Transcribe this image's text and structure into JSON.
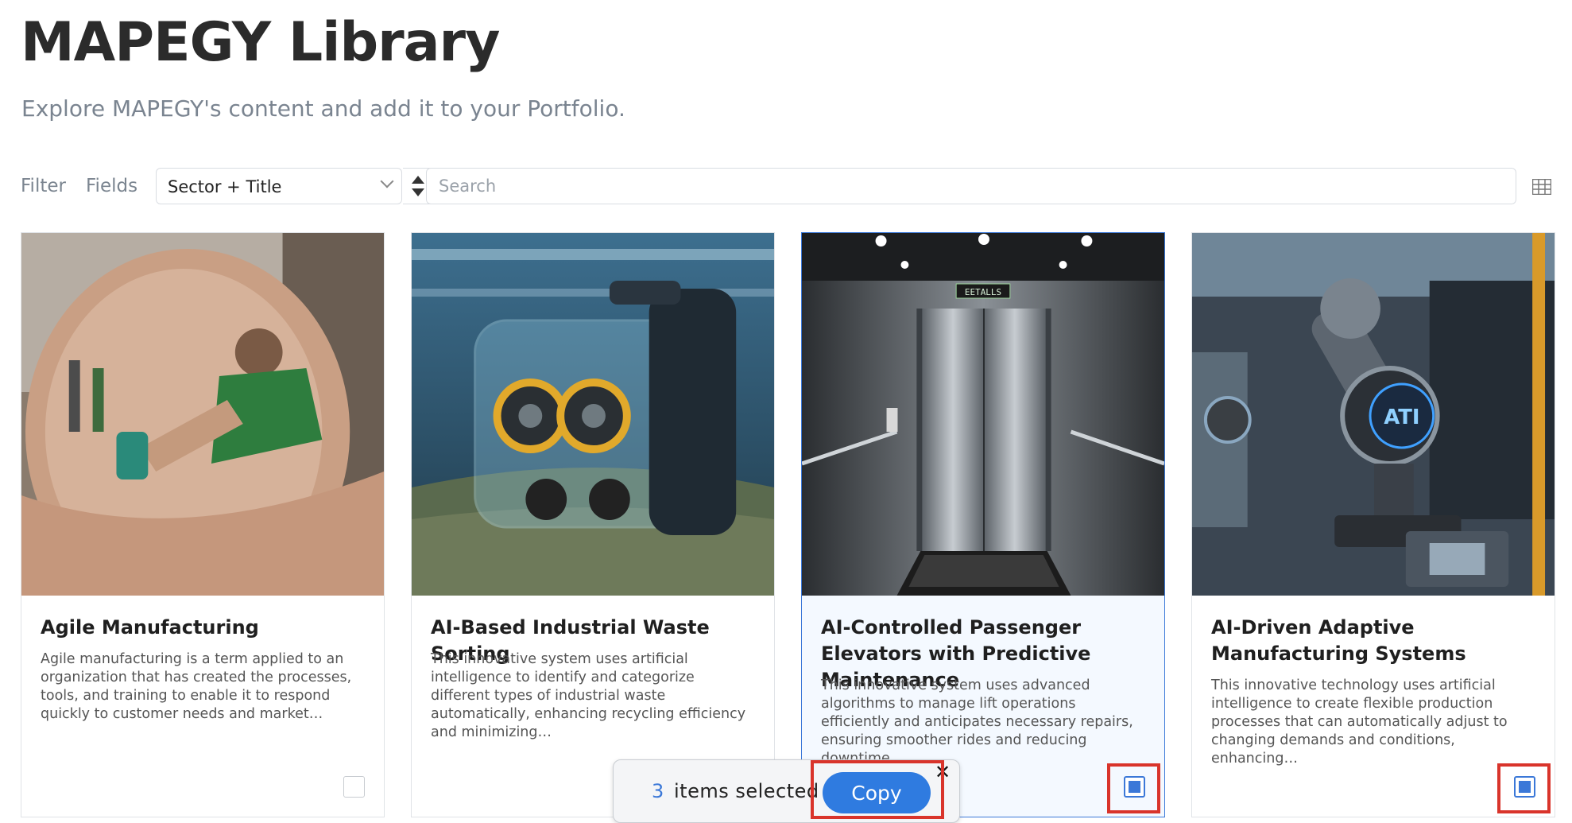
{
  "header": {
    "title": "MAPEGY Library",
    "subtitle": "Explore MAPEGY's content and add it to your Portfolio."
  },
  "toolbar": {
    "filter_label": "Filter",
    "fields_label": "Fields",
    "sort_field": "Sector + Title",
    "search_placeholder": "Search",
    "view_icon": "grid-icon"
  },
  "cards": [
    {
      "title": "Agile Manufacturing",
      "description": "Agile manufacturing is a term applied to an organization that has created the processes, tools, and training to enable it to respond quickly to customer needs and market…",
      "selected": false,
      "image": "worker-drilling-in-tube"
    },
    {
      "title": "AI-Based Industrial Waste Sorting",
      "description": "This innovative system uses artificial intelligence to identify and categorize different types of industrial waste automatically, enhancing recycling efficiency and minimizing…",
      "selected": false,
      "image": "sorting-robot-on-waste-pile"
    },
    {
      "title": "AI-Controlled Passenger Elevators with Predictive Maintenance",
      "description": "This innovative system uses advanced algorithms to manage lift operations efficiently and anticipates necessary repairs, ensuring smoother rides and reducing downtime.",
      "selected": true,
      "image": "elevator-interior",
      "sign_text": "EETALLS"
    },
    {
      "title": "AI-Driven Adaptive Manufacturing Systems",
      "description": "This innovative technology uses artificial intelligence to create flexible production processes that can automatically adjust to changing demands and conditions, enhancing…",
      "selected": true,
      "image": "robotic-arm-factory",
      "badge_text": "ATI"
    }
  ],
  "selection_bar": {
    "count": "3",
    "text": "items selected",
    "copy_label": "Copy",
    "close_glyph": "✕"
  },
  "colors": {
    "accent": "#2f7be0",
    "highlight": "#d9342b",
    "selected_border": "#3b78d8"
  }
}
